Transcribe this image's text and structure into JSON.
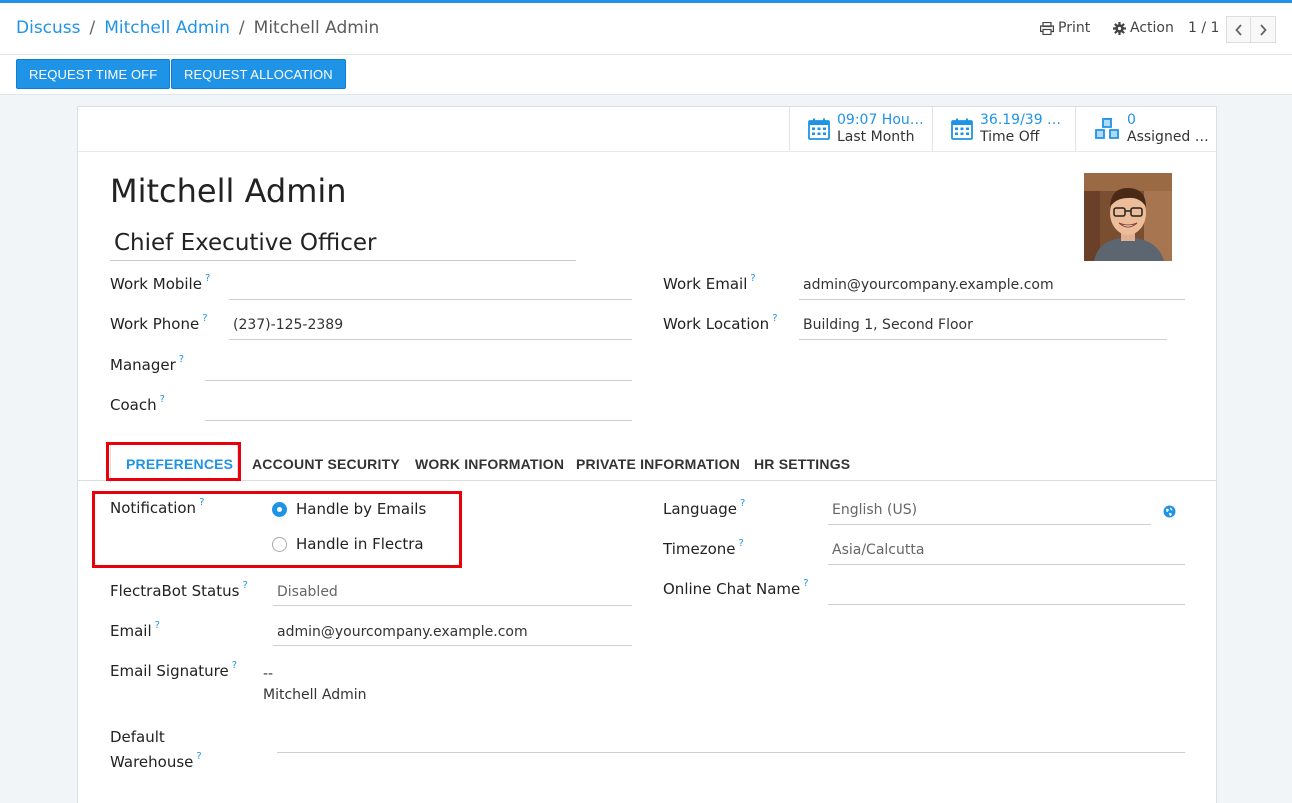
{
  "breadcrumb": {
    "items": [
      "Discuss",
      "Mitchell Admin",
      "Mitchell Admin"
    ],
    "separator": "/"
  },
  "control_panel": {
    "print_label": "Print",
    "action_label": "Action",
    "pager_value": "1 / 1"
  },
  "buttons": {
    "request_time_off": "REQUEST TIME OFF",
    "request_allocation": "REQUEST ALLOCATION"
  },
  "stat_buttons": [
    {
      "value": "09:07 Hou…",
      "label": "Last Month",
      "icon": "calendar-icon"
    },
    {
      "value": "36.19/39 …",
      "label": "Time Off",
      "icon": "calendar-icon"
    },
    {
      "value": "0",
      "label": "Assigned …",
      "icon": "cubes-icon"
    }
  ],
  "employee": {
    "name": "Mitchell Admin",
    "job_title": "Chief Executive Officer"
  },
  "fields": {
    "work_mobile": {
      "label": "Work Mobile",
      "value": ""
    },
    "work_phone": {
      "label": "Work Phone",
      "value": "(237)-125-2389"
    },
    "manager": {
      "label": "Manager",
      "value": ""
    },
    "coach": {
      "label": "Coach",
      "value": ""
    },
    "work_email": {
      "label": "Work Email",
      "value": "admin@yourcompany.example.com"
    },
    "work_location": {
      "label": "Work Location",
      "value": "Building 1, Second Floor"
    }
  },
  "help_mark": "?",
  "tabs": [
    "PREFERENCES",
    "ACCOUNT SECURITY",
    "WORK INFORMATION",
    "PRIVATE INFORMATION",
    "HR SETTINGS"
  ],
  "preferences": {
    "notification": {
      "label": "Notification",
      "options": [
        "Handle by Emails",
        "Handle in Flectra"
      ],
      "selected": "Handle by Emails"
    },
    "flectrabot_status": {
      "label": "FlectraBot Status",
      "value": "Disabled"
    },
    "email": {
      "label": "Email",
      "value": "admin@yourcompany.example.com"
    },
    "email_signature": {
      "label": "Email Signature",
      "line1": "--",
      "line2": "Mitchell Admin"
    },
    "default_warehouse": {
      "label_line1": "Default",
      "label_line2": "Warehouse",
      "value": ""
    },
    "language": {
      "label": "Language",
      "value": "English (US)"
    },
    "timezone": {
      "label": "Timezone",
      "value": "Asia/Calcutta"
    },
    "online_chat_name": {
      "label": "Online Chat Name",
      "value": ""
    }
  },
  "colors": {
    "accent": "#1f94e6",
    "highlight": "#e8000b"
  }
}
